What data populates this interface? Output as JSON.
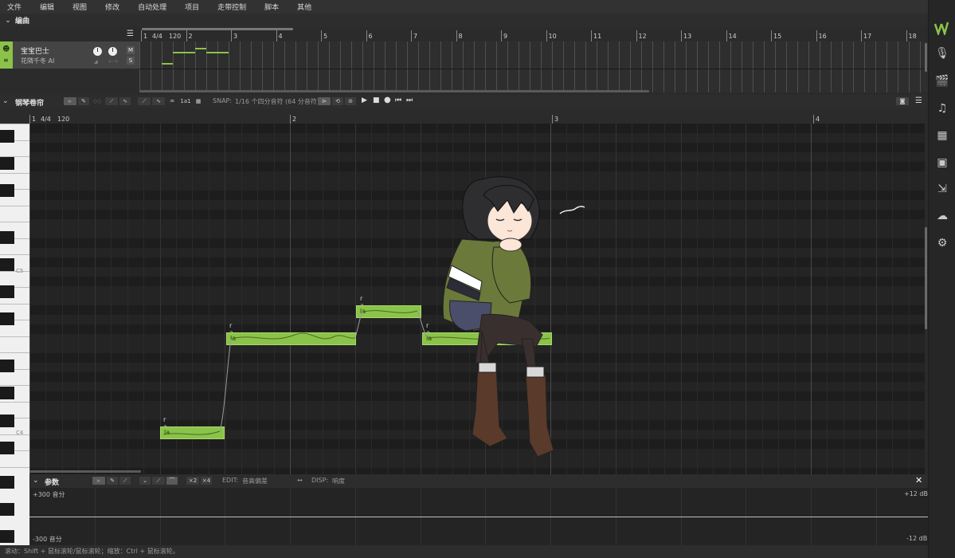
{
  "menu": [
    "文件",
    "编辑",
    "视图",
    "修改",
    "自动处理",
    "项目",
    "走带控制",
    "脚本",
    "其他"
  ],
  "arrangement": {
    "title": "编曲",
    "track": {
      "name": "宝宝巴士",
      "voice": "花隣千冬 AI",
      "mute": "M",
      "solo": "S"
    },
    "ruler": {
      "time_sig": "4/4",
      "tempo": "120",
      "bars": [
        "1",
        "2",
        "3",
        "4",
        "5",
        "6",
        "7",
        "8",
        "9",
        "10",
        "11",
        "12",
        "13",
        "14",
        "15",
        "16",
        "17",
        "18"
      ]
    }
  },
  "piano_roll": {
    "title": "钢琴卷帘",
    "snap_label": "SNAP:",
    "snap_value": "1/16 个四分音符 (64 分音符)",
    "ruler": {
      "time_sig": "4/4",
      "tempo": "120",
      "bars": [
        "1",
        "2",
        "3",
        "4"
      ]
    },
    "key_labels": {
      "c5": "C5",
      "c4": "C4"
    },
    "notes": [
      {
        "lyric": "la",
        "phoneme": "r a"
      },
      {
        "lyric": "la",
        "phoneme": "r a"
      },
      {
        "lyric": "la",
        "phoneme": "r a"
      },
      {
        "lyric": "la",
        "phoneme": "r a"
      }
    ]
  },
  "parameters": {
    "title": "参数",
    "mult2": "×2",
    "mult4": "×4",
    "edit_label": "EDIT:",
    "edit_value": "音高偏差",
    "disp_label": "DISP:",
    "disp_value": "响度",
    "top_left": "+300 音分",
    "bottom_left": "-300 音分",
    "top_right": "+12 dB",
    "bottom_right": "-12 dB"
  },
  "status": "滚动：Shift + 鼠标滚轮/鼠标滚轮；缩放：Ctrl + 鼠标滚轮。",
  "colors": {
    "note": "#8bc34a",
    "accent": "#8bc34a",
    "background": "#2b2b2b"
  },
  "icons": [
    "app-logo-icon",
    "microphone-icon",
    "clapperboard-icon",
    "music-note-icon",
    "library-icon",
    "book-icon",
    "export-icon",
    "cloud-icon",
    "settings-icon"
  ]
}
